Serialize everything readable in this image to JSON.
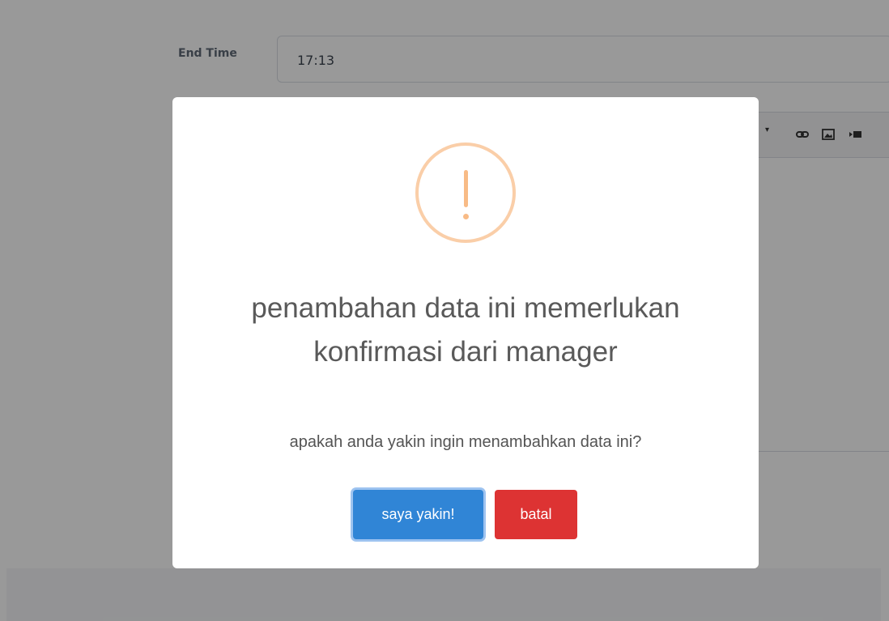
{
  "form": {
    "end_time_label": "End Time",
    "end_time_value": "17:13"
  },
  "editor_toolbar": {
    "icons": [
      "caret-down-icon",
      "link-icon",
      "image-icon",
      "video-icon"
    ]
  },
  "modal": {
    "title": "penambahan data ini memerlukan konfirmasi dari manager",
    "text": "apakah anda yakin ingin menambahkan data ini?",
    "confirm_label": "saya yakin!",
    "cancel_label": "batal",
    "icon": "warning-icon"
  },
  "colors": {
    "confirm": "#3085d6",
    "cancel": "#dd3333",
    "warning": "#f8bb86"
  }
}
